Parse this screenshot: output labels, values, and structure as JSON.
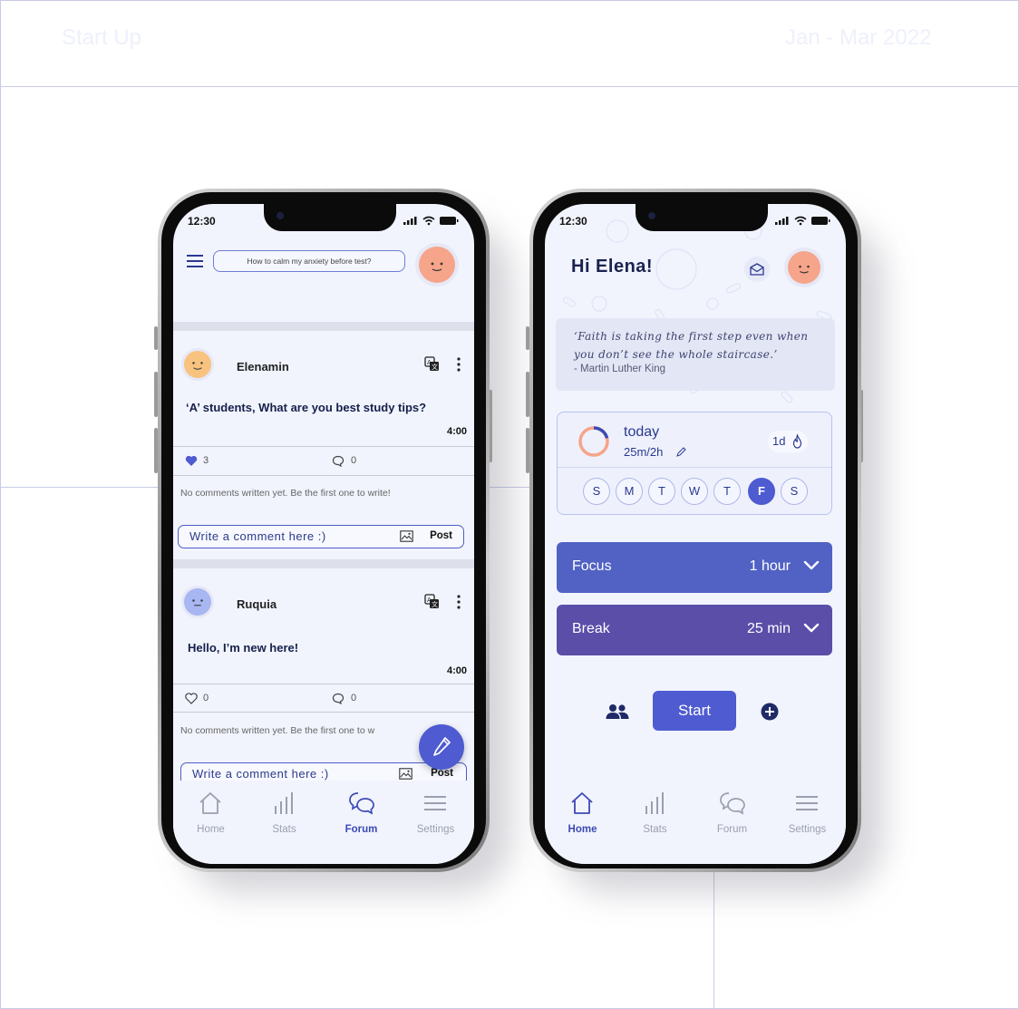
{
  "header": {
    "project": "Start Up",
    "period": "Jan - Mar 2022"
  },
  "status_bar": {
    "time": "12:30"
  },
  "forum_screen": {
    "search_placeholder": "How to calm my anxiety before test?",
    "posts": [
      {
        "author": "Elenamin",
        "text": "‘A’ students, What are you best study tips?",
        "time": "4:00",
        "likes": "3",
        "comments": "0",
        "liked": true,
        "no_comments": "No comments written yet. Be the first one to write!",
        "comment_placeholder": "Write a comment here :)",
        "post_label": "Post"
      },
      {
        "author": "Ruquia",
        "text": "Hello, I’m new here!",
        "time": "4:00",
        "likes": "0",
        "comments": "0",
        "liked": false,
        "no_comments": "No comments written yet. Be the first one to w",
        "comment_placeholder": "Write a comment here :)",
        "post_label": "Post"
      }
    ]
  },
  "home_screen": {
    "greeting": "Hi Elena!",
    "quote": {
      "text": "‘Faith is taking the first step even when you don’t see the whole staircase.’",
      "author": "- Martin Luther King"
    },
    "today": {
      "title": "today",
      "progress": "25m/2h",
      "progress_fraction": 0.21,
      "streak": "1d"
    },
    "days": [
      {
        "label": "S",
        "active": false
      },
      {
        "label": "M",
        "active": false
      },
      {
        "label": "T",
        "active": false
      },
      {
        "label": "W",
        "active": false
      },
      {
        "label": "T",
        "active": false
      },
      {
        "label": "F",
        "active": true
      },
      {
        "label": "S",
        "active": false
      }
    ],
    "focus": {
      "label": "Focus",
      "value": "1 hour"
    },
    "break": {
      "label": "Break",
      "value": "25 min"
    },
    "start_label": "Start"
  },
  "nav": {
    "items": [
      "Home",
      "Stats",
      "Forum",
      "Settings"
    ],
    "forum_active": "Forum",
    "home_active": "Home"
  },
  "colors": {
    "accent": "#4e5bd1",
    "focus": "#5162c4",
    "break": "#5a4ea8",
    "avatar_orange": "#f6a48a",
    "avatar_yellow": "#f7c37f",
    "avatar_blue": "#a8b6f2"
  }
}
